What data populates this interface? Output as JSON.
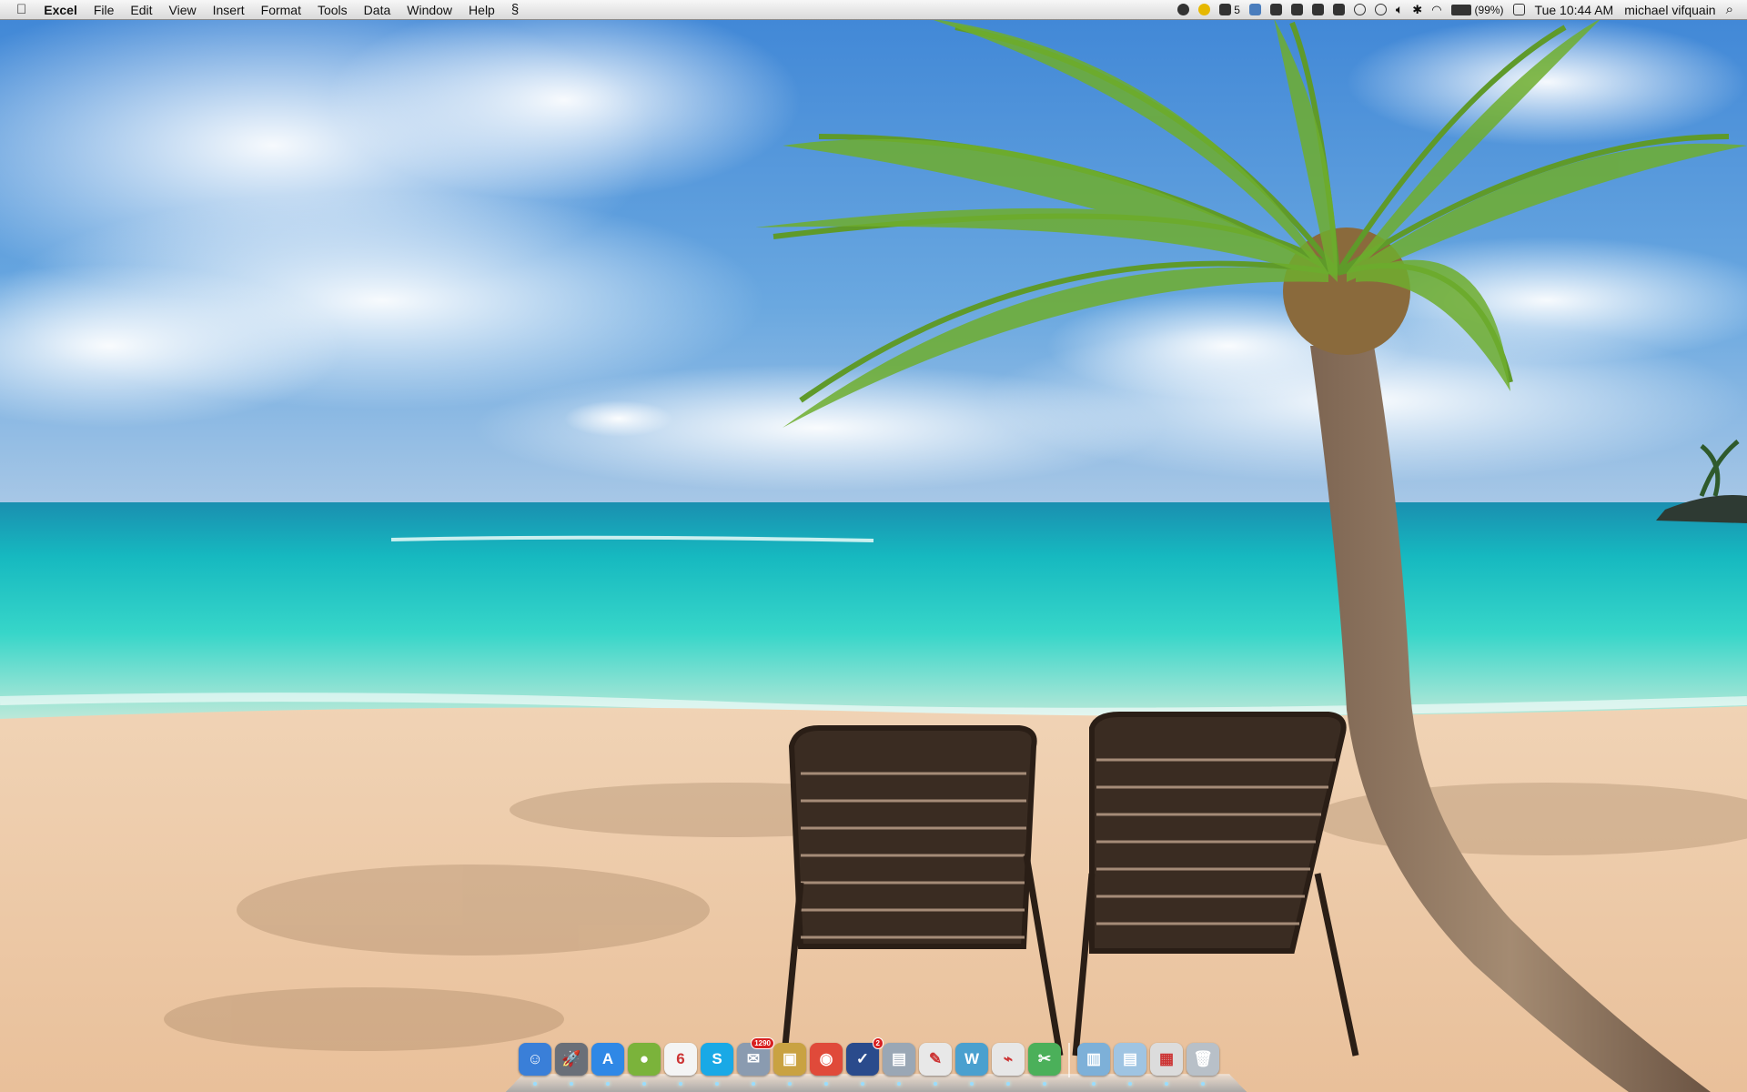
{
  "menubar": {
    "app_name": "Excel",
    "menus": [
      "File",
      "Edit",
      "View",
      "Insert",
      "Format",
      "Tools",
      "Data",
      "Window",
      "Help"
    ],
    "script_icon": "script-menu-icon",
    "status_icons": [
      "gear-status-icon",
      "clock-status-icon",
      "adobe-status-icon",
      "dropbox-status-icon",
      "x-status-icon",
      "scissors-status-icon",
      "chat-status-icon",
      "evernote-status-icon",
      "sync-status-icon",
      "time-machine-status-icon",
      "volume-status-icon",
      "bluetooth-status-icon",
      "wifi-status-icon"
    ],
    "notification_count": "5",
    "battery_percent": "(99%)",
    "clock": "Tue 10:44 AM",
    "user": "michael vifquain"
  },
  "dock": {
    "items": [
      {
        "name": "finder",
        "glyph": "☺",
        "color": "#3a7fd8"
      },
      {
        "name": "launchpad",
        "glyph": "🚀",
        "color": "#6a6f78"
      },
      {
        "name": "app-store",
        "glyph": "A",
        "color": "#2f88e6"
      },
      {
        "name": "growl",
        "glyph": "●",
        "color": "#7bb33b"
      },
      {
        "name": "calendar",
        "glyph": "6",
        "color": "#f4f4f4"
      },
      {
        "name": "skype",
        "glyph": "S",
        "color": "#19a9e6"
      },
      {
        "name": "mail",
        "glyph": "✉",
        "color": "#8a9bb0",
        "badge": "1290"
      },
      {
        "name": "transmit",
        "glyph": "▣",
        "color": "#c9a242"
      },
      {
        "name": "chrome",
        "glyph": "◉",
        "color": "#e04a3a"
      },
      {
        "name": "things",
        "glyph": "✓",
        "color": "#2a4b8c",
        "badge": "2"
      },
      {
        "name": "preview",
        "glyph": "▤",
        "color": "#9aa7b5"
      },
      {
        "name": "textedit",
        "glyph": "✎",
        "color": "#e8e8e8"
      },
      {
        "name": "wunderlist",
        "glyph": "W",
        "color": "#4aa0cf"
      },
      {
        "name": "acrobat",
        "glyph": "⌁",
        "color": "#e7e7e7"
      },
      {
        "name": "scissors-app",
        "glyph": "✂",
        "color": "#4bb05a"
      },
      {
        "name": "applications-folder",
        "glyph": "▥",
        "color": "#7db0d8"
      },
      {
        "name": "documents-folder",
        "glyph": "▤",
        "color": "#9fc4e2"
      },
      {
        "name": "downloads-stack",
        "glyph": "▦",
        "color": "#dcdcdc"
      },
      {
        "name": "trash",
        "glyph": "🗑",
        "color": "#b8c0c8"
      }
    ]
  }
}
